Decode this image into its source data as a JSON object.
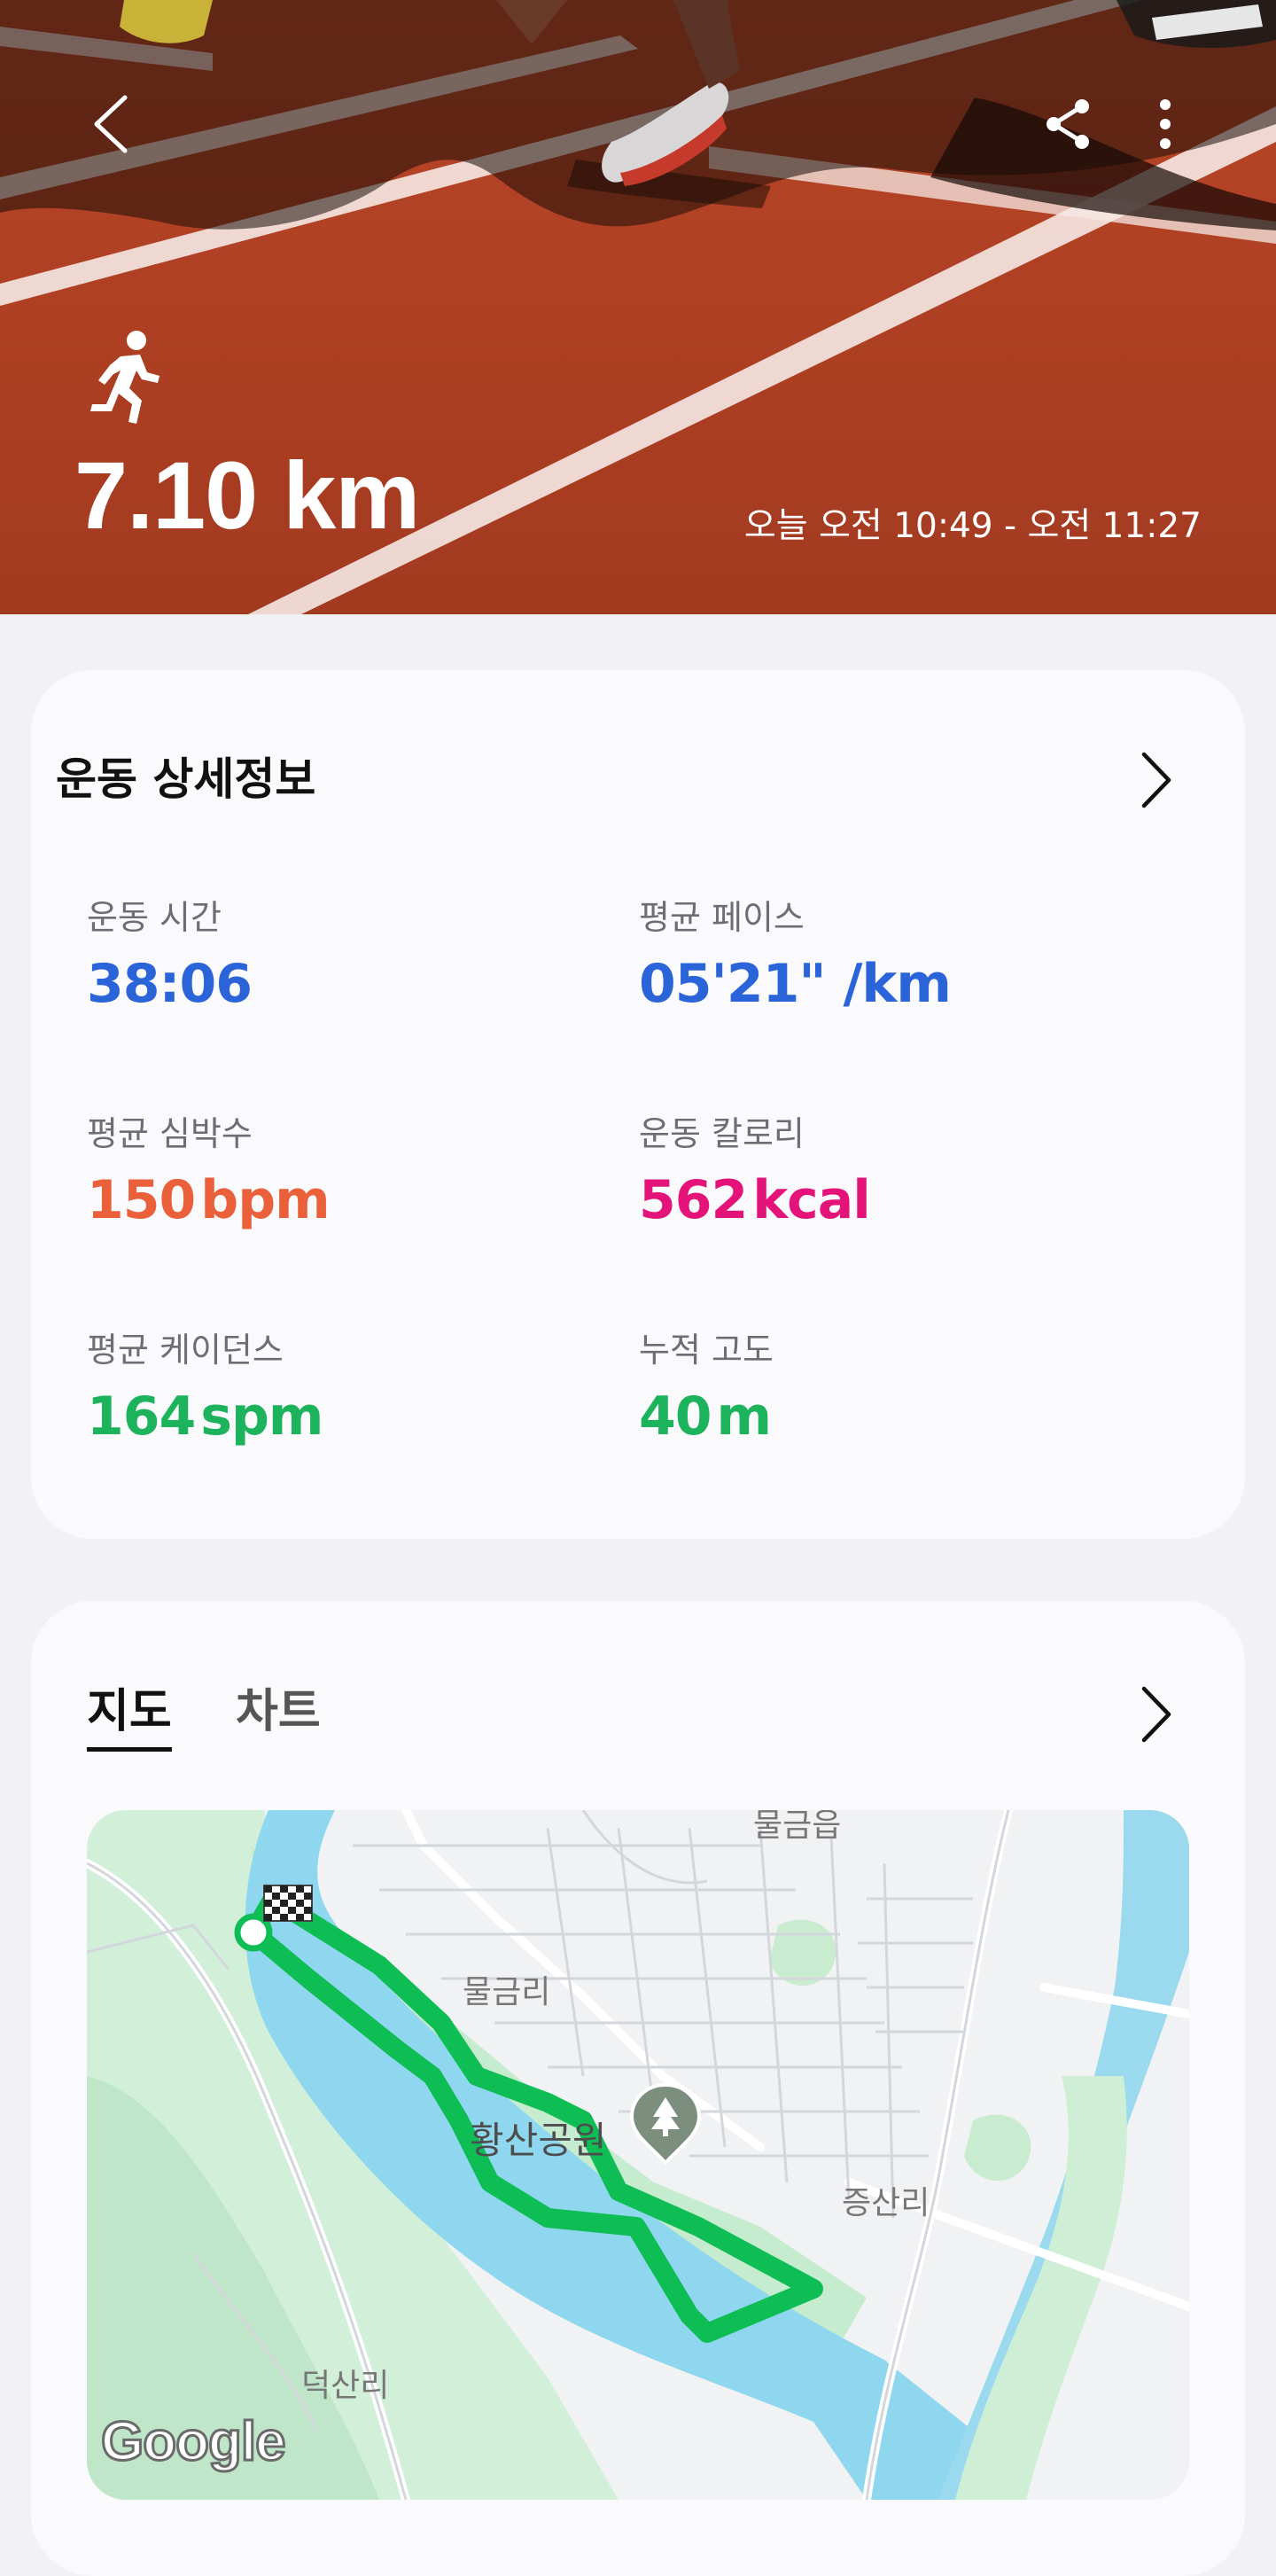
{
  "header": {
    "distance": "7.10 km",
    "time_range": "오늘 오전 10:49 - 오전 11:27",
    "activity_icon": "running-icon",
    "back_icon": "chevron-left-icon",
    "share_icon": "share-icon",
    "more_icon": "more-vertical-icon"
  },
  "details": {
    "title": "운동 상세정보",
    "stats": [
      {
        "label": "운동 시간",
        "value": "38:06",
        "unit": "",
        "color": "#2a64d8"
      },
      {
        "label": "평균 페이스",
        "value": "05'21\" /km",
        "unit": "",
        "color": "#2a64d8"
      },
      {
        "label": "평균 심박수",
        "value": "150",
        "unit": "bpm",
        "color": "#e9603a"
      },
      {
        "label": "운동 칼로리",
        "value": "562",
        "unit": "kcal",
        "color": "#e3137a"
      },
      {
        "label": "평균 케이던스",
        "value": "164",
        "unit": "spm",
        "color": "#1cb35c"
      },
      {
        "label": "누적 고도",
        "value": "40",
        "unit": "m",
        "color": "#1cb35c"
      }
    ]
  },
  "map_section": {
    "tabs": [
      "지도",
      "차트"
    ],
    "active_tab": "지도",
    "labels": {
      "top": "물금읍",
      "village1": "물금리",
      "park": "황산공원",
      "village2": "증산리",
      "village3": "덕산리"
    },
    "attribution": "Google"
  },
  "colors": {
    "route": "#0fbd55",
    "river": "#8fd7ee",
    "park_green": "#c5eccf",
    "accent_blue": "#2a64d8"
  }
}
